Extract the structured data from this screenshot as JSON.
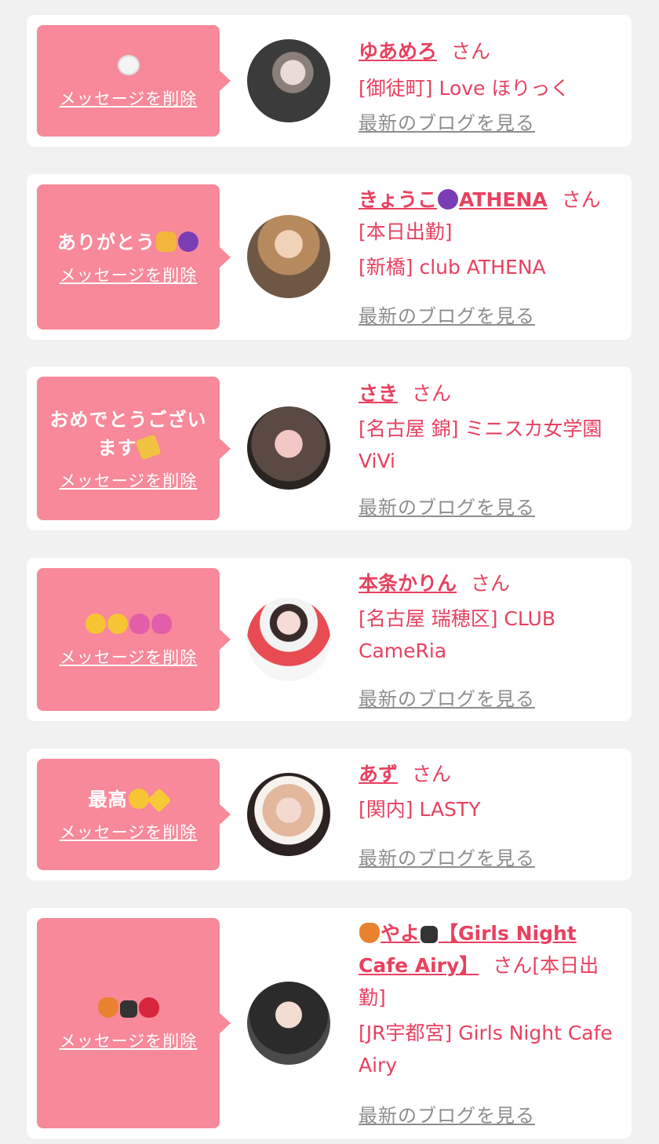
{
  "delete_label": "メッセージを削除",
  "blog_label": "最新のブログを見る",
  "san": "さん",
  "cards": [
    {
      "message": "",
      "emojis": [
        "white-heart"
      ],
      "name": "ゆあめろ",
      "suffix": "",
      "shop": "[御徒町] Love ほりっく",
      "avatar_color": "#3b3b3b"
    },
    {
      "message": "ありがとう",
      "emojis_after": [
        "heart-hands",
        "smiling-devil"
      ],
      "name": "きょうこ",
      "name_emoji": "smiling-devil",
      "name_tail": "ATHENA",
      "suffix": "[本日出勤]",
      "shop": "[新橋] club ATHENA",
      "avatar_color": "#b78a5e"
    },
    {
      "message": "おめでとうございます",
      "emojis_after": [
        "party-popper"
      ],
      "name": "さき",
      "suffix": "",
      "shop": "[名古屋 錦] ミニスカ女学園ViVi",
      "avatar_color": "#5a4a43"
    },
    {
      "message": "",
      "emojis": [
        "pleading-face",
        "pleading-face",
        "pink-heart",
        "pink-heart"
      ],
      "name": "本条かりん",
      "suffix": "",
      "shop": "[名古屋 瑞穂区] CLUB CameRia",
      "avatar_color": "#e84b52"
    },
    {
      "message": "最高",
      "emojis_after": [
        "grinning-squint",
        "star"
      ],
      "name": "あず",
      "suffix": "",
      "shop": "[関内] LASTY",
      "avatar_color": "#c7a48a"
    },
    {
      "message": "",
      "emojis": [
        "fox",
        "paw-prints",
        "red-heart"
      ],
      "name": "やよ",
      "name_emoji": "fox",
      "name_tail": "【Girls Night Cafe Airy】",
      "suffix": "[本日出勤]",
      "shop": "[JR宇都宮] Girls Night Cafe Airy",
      "avatar_color": "#2b2b2b"
    }
  ]
}
